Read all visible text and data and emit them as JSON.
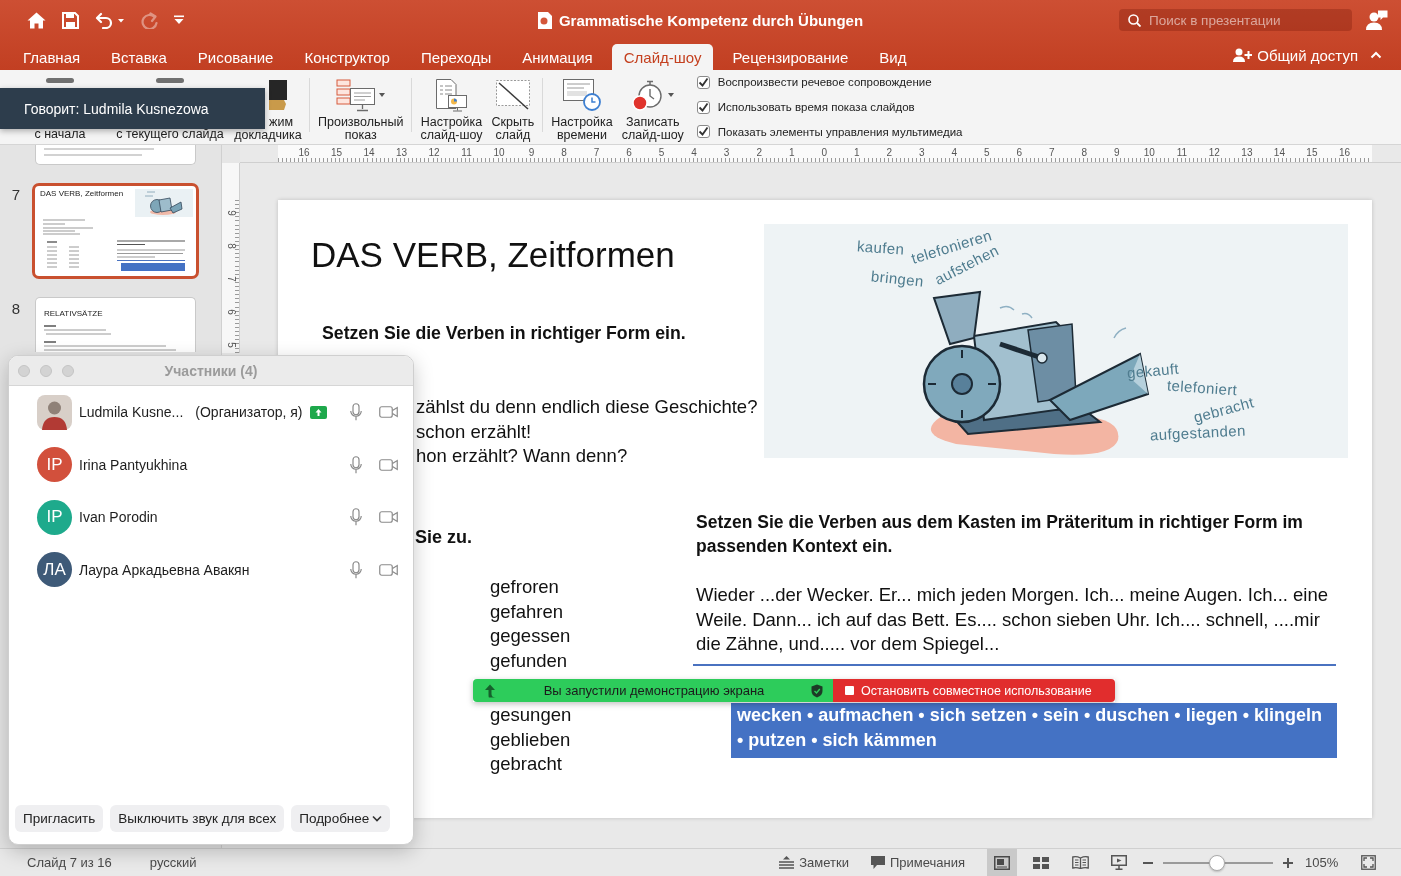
{
  "quick_access": [
    {
      "kind": "home",
      "disabled": false
    },
    {
      "kind": "save",
      "disabled": false
    },
    {
      "kind": "undo",
      "disabled": false
    },
    {
      "kind": "redo",
      "disabled": true
    },
    {
      "kind": "customize",
      "disabled": false
    }
  ],
  "title_bar": {
    "title": "Grammatische Kompetenz durch Übungen",
    "search": {
      "placeholder": "Поиск в презентации"
    }
  },
  "ribbon_tabs": [
    {
      "label": "Главная",
      "selected": false
    },
    {
      "label": "Вставка",
      "selected": false
    },
    {
      "label": "Рисование",
      "selected": false
    },
    {
      "label": "Конструктор",
      "selected": false
    },
    {
      "label": "Переходы",
      "selected": false
    },
    {
      "label": "Анимация",
      "selected": false
    },
    {
      "label": "Слайд-шоу",
      "selected": true
    },
    {
      "label": "Рецензирование",
      "selected": false
    },
    {
      "label": "Вид",
      "selected": false
    }
  ],
  "share_button": {
    "label": "Общий доступ"
  },
  "ribbon_groups": [
    [
      {
        "kind": "from-start",
        "lines": [
          "с начала"
        ]
      },
      {
        "kind": "from-current",
        "lines": [
          "с текущего слайда"
        ]
      },
      {
        "kind": "presenter",
        "lines": [
          "жим",
          "докладчика"
        ]
      }
    ],
    [
      {
        "kind": "custom-show",
        "lines": [
          "Произвольный",
          "показ"
        ]
      }
    ],
    [
      {
        "kind": "setup",
        "lines": [
          "Настройка",
          "слайд-шоу"
        ]
      },
      {
        "kind": "hide",
        "lines": [
          "Скрыть",
          "слайд"
        ]
      }
    ],
    [
      {
        "kind": "timing",
        "lines": [
          "Настройка",
          "времени"
        ]
      },
      {
        "kind": "record",
        "lines": [
          "Записать",
          "слайд-шоу"
        ]
      }
    ]
  ],
  "ribbon_checkboxes": [
    {
      "label": "Воспроизвести речевое сопровождение",
      "checked": true
    },
    {
      "label": "Использовать время показа слайдов",
      "checked": true
    },
    {
      "label": "Показать элементы управления мультимедиа",
      "checked": true
    }
  ],
  "speaker_tooltip": {
    "text": "Говорит: Ludmila Kusnezowa"
  },
  "horizontal_ruler": [
    "16",
    "15",
    "14",
    "13",
    "12",
    "11",
    "10",
    "9",
    "8",
    "7",
    "6",
    "5",
    "4",
    "3",
    "2",
    "1",
    "0",
    "1",
    "2",
    "3",
    "4",
    "5",
    "6",
    "7",
    "8",
    "9",
    "10",
    "11",
    "12",
    "13",
    "14",
    "15",
    "16"
  ],
  "vertical_ruler": [
    "9",
    "8",
    "7",
    "6",
    "5"
  ],
  "thumbnails": [
    {
      "kind": "cut",
      "selected": false
    },
    {
      "kind": "image-slide",
      "number": "7",
      "title": "DAS VERB, Zeitformen",
      "selected": true
    },
    {
      "kind": "text-slide",
      "number": "8",
      "title": "RELATIVSÄTZE",
      "selected": false
    }
  ],
  "slide": {
    "title": "DAS VERB, Zeitformen",
    "illustration_words": [
      "kaufen",
      "telefonieren",
      "bringen",
      "aufstehen",
      "gekauft",
      "telefoniert",
      "gebracht",
      "aufgestanden"
    ],
    "task_1": "Setzen Sie die Verben in richtiger Form ein.",
    "example_lines": [
      "zählst du denn endlich diese Geschichte?",
      "schon erzählt!",
      "hon erzählt? Wann denn?"
    ],
    "task_2": "Sie zu.",
    "participles_above": [
      "gefroren",
      "gefahren",
      "gegessen",
      "gefunden"
    ],
    "participles_below": [
      "gesungen",
      "geblieben",
      "gebracht"
    ],
    "task_3": "Setzen Sie die Verben aus dem Kasten im Präteritum in richtiger Form im passenden Kontext ein.",
    "text": "Wieder ...der Wecker. Er... mich jeden Morgen. Ich... meine Augen. Ich... eine Weile. Dann... ich auf das Bett. Es.... schon sieben Uhr. Ich.... schnell, ....mir die Zähne, und..... vor dem Spiegel...",
    "verb_box": "wecken • aufmachen • sich setzen • sein • duschen • liegen • klingeln • putzen • sich kämmen"
  },
  "participants_window": {
    "title": "Участники (4)",
    "participants": [
      {
        "kind": "photo",
        "name": "Ludmila Kusne...",
        "role": "(Организатор, я)",
        "sharing": true
      },
      {
        "kind": "initials",
        "initials": "IP",
        "color": "#d2503c",
        "name": "Irina Pantyukhina",
        "sharing": false
      },
      {
        "kind": "initials",
        "initials": "IP",
        "color": "#1eaa8c",
        "name": "Ivan Porodin",
        "sharing": false
      },
      {
        "kind": "initials",
        "initials": "ЛА",
        "color": "#3e5a78",
        "name": "Лаура Аркадьевна Авакян",
        "sharing": false
      }
    ],
    "buttons": [
      {
        "kind": "plain",
        "label": "Пригласить"
      },
      {
        "kind": "plain",
        "label": "Выключить звук для всех"
      },
      {
        "kind": "menu",
        "label": "Подробнее"
      }
    ]
  },
  "share_banner": {
    "text": "Вы запустили демонстрацию экрана",
    "stop_label": "Остановить совместное использование"
  },
  "status_bar": {
    "slide": "Слайд 7 из 16",
    "language": "русский",
    "notes": "Заметки",
    "comments": "Примечания",
    "views": [
      {
        "kind": "normal",
        "selected": true
      },
      {
        "kind": "sorter",
        "selected": false
      },
      {
        "kind": "reading",
        "selected": false
      },
      {
        "kind": "slideshow",
        "selected": false
      }
    ],
    "zoom": {
      "level": 0.49,
      "reading": "105%"
    }
  }
}
